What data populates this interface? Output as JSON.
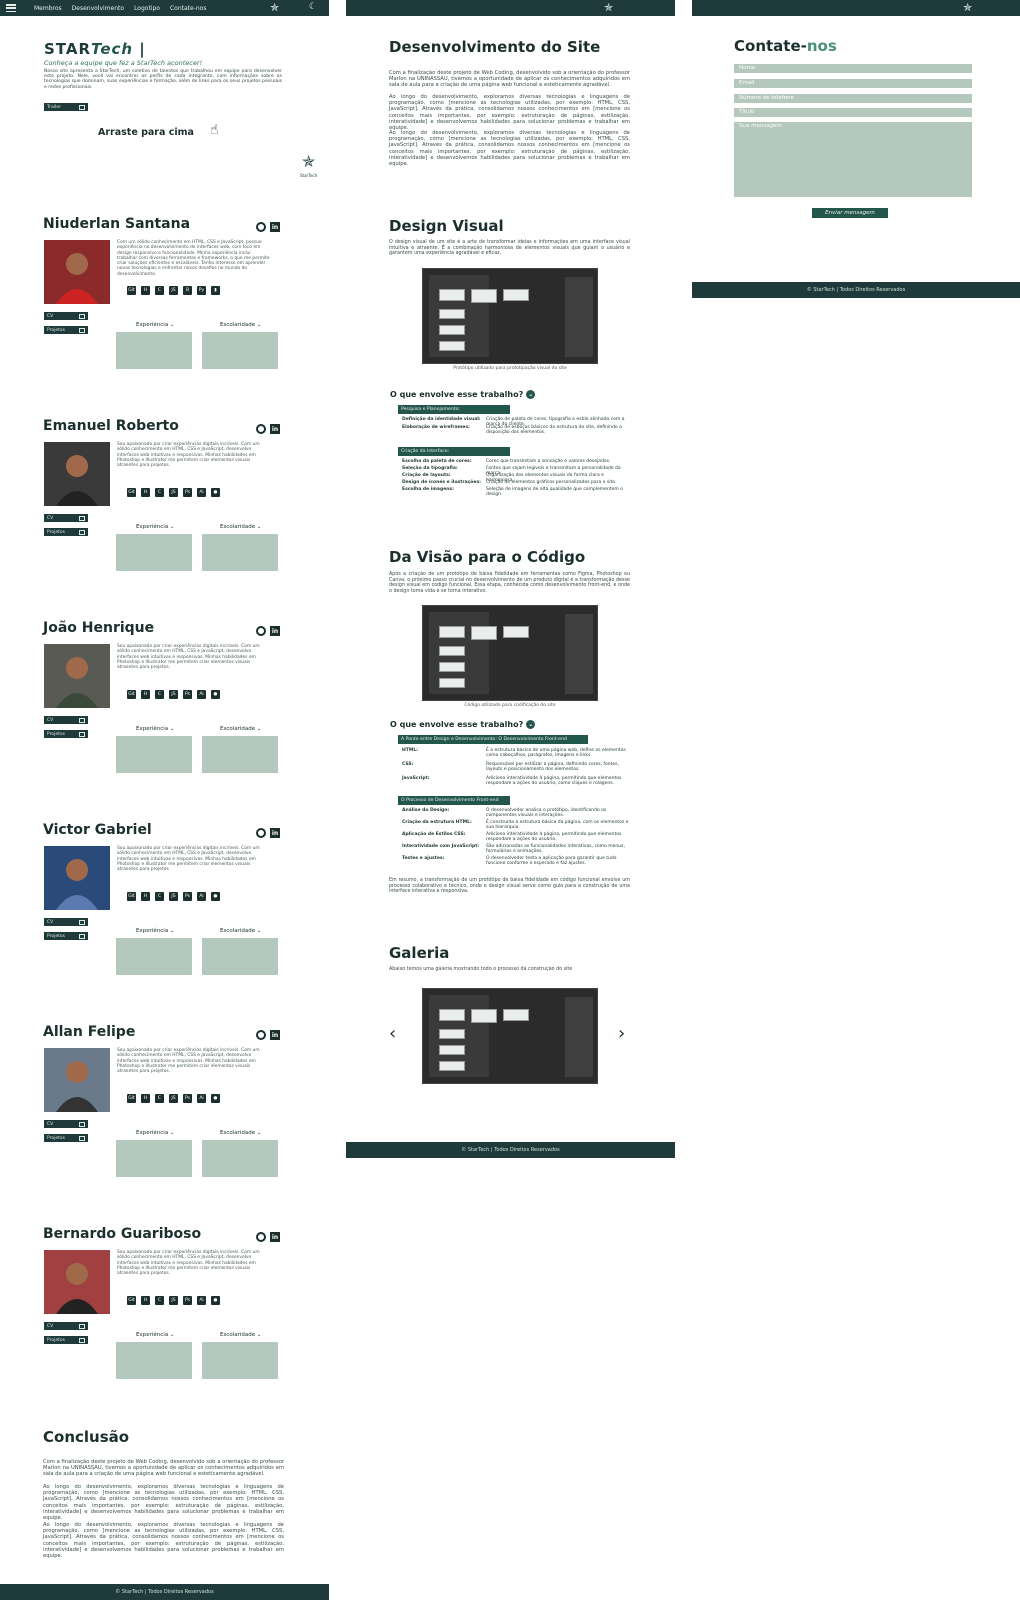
{
  "nav": {
    "links": [
      "Membros",
      "Desenvolvimento",
      "Logotipo",
      "Contate-nos"
    ]
  },
  "hero": {
    "brand_a": "STAR",
    "brand_b": "Tech",
    "tagline": "Conheça a equipe que fez a StarTech acontecer!",
    "text": "Nosso site apresenta a StarTech, um coletivo de talentos que trabalhou em equipe para desenvolver este projeto. Nele, você vai encontrar os perfis de cada integrante, com informações sobre as tecnologias que dominam, suas experiências e formação, além de links para os seus projetos pessoais e redes profissionais.",
    "button": "Trailer",
    "drag_hint": "Arraste para cima",
    "logo_caption": "StarTech"
  },
  "labels": {
    "cv": "CV",
    "projects": "Projetos",
    "experience": "Experiência",
    "education": "Escolaridade"
  },
  "members": [
    {
      "name": "Niuderlan Santana",
      "bio": "Com um sólido conhecimento em HTML, CSS e JavaScript, possuo experiência no desenvolvimento de interfaces web, com foco em design responsivo e funcionalidade. Minha experiência inclui trabalhar com diversas ferramentas e frameworks, o que me permite criar soluções eficientes e escaláveis. Tenho interesse em aprender novas tecnologias e enfrentar novos desafios no mundo do desenvolvimento.",
      "techs": [
        "Git",
        "H",
        "C",
        "JS",
        "B",
        "Py",
        "▮"
      ],
      "photo_bg": "#8a2a2a",
      "photo_fg": "#c22"
    },
    {
      "name": "Emanuel Roberto",
      "bio": "Sou apaixonado por criar experiências digitais incríveis. Com um sólido conhecimento em HTML, CSS e JavaScript, desenvolvo interfaces web intuitivas e responsivas. Minhas habilidades em Photoshop e Illustrator me permitem criar elementos visuais atraentes para projetos.",
      "techs": [
        "Git",
        "H",
        "C",
        "JS",
        "Ps",
        "Ai",
        "●"
      ],
      "photo_bg": "#3a3a3a",
      "photo_fg": "#222"
    },
    {
      "name": "João Henrique",
      "bio": "Sou apaixonado por criar experiências digitais incríveis. Com um sólido conhecimento em HTML, CSS e JavaScript, desenvolvo interfaces web intuitivas e responsivas. Minhas habilidades em Photoshop e Illustrator me permitem criar elementos visuais atraentes para projetos.",
      "techs": [
        "Git",
        "H",
        "C",
        "JS",
        "Ps",
        "Ai",
        "●"
      ],
      "photo_bg": "#5a5a55",
      "photo_fg": "#3a4a3a"
    },
    {
      "name": "Victor Gabriel",
      "bio": "Sou apaixonado por criar experiências digitais incríveis. Com um sólido conhecimento em HTML, CSS e JavaScript, desenvolvo interfaces web intuitivas e responsivas. Minhas habilidades em Photoshop e Illustrator me permitem criar elementos visuais atraentes para projetos.",
      "techs": [
        "Git",
        "H",
        "C",
        "JS",
        "Ps",
        "Ai",
        "●"
      ],
      "photo_bg": "#2a4a7a",
      "photo_fg": "#5a7ab0"
    },
    {
      "name": "Allan Felipe",
      "bio": "Sou apaixonado por criar experiências digitais incríveis. Com um sólido conhecimento em HTML, CSS e JavaScript, desenvolvo interfaces web intuitivas e responsivas. Minhas habilidades em Photoshop e Illustrator me permitem criar elementos visuais atraentes para projetos.",
      "techs": [
        "Git",
        "H",
        "C",
        "JS",
        "Ps",
        "Ai",
        "●"
      ],
      "photo_bg": "#6a7a8a",
      "photo_fg": "#333"
    },
    {
      "name": "Bernardo Guariboso",
      "bio": "Sou apaixonado por criar experiências digitais incríveis. Com um sólido conhecimento em HTML, CSS e JavaScript, desenvolvo interfaces web intuitivas e responsivas. Minhas habilidades em Photoshop e Illustrator me permitem criar elementos visuais atraentes para projetos.",
      "techs": [
        "Git",
        "H",
        "C",
        "JS",
        "Ps",
        "Ai",
        "●"
      ],
      "photo_bg": "#a04040",
      "photo_fg": "#222"
    }
  ],
  "conclusion": {
    "title": "Conclusão",
    "p1": "Com a finalização deste projeto de Web Coding, desenvolvido sob a orientação do professor Marlon na UNINASSAU, tivemos a oportunidade de aplicar os conhecimentos adquiridos em sala de aula para a criação de uma página web funcional e esteticamente agradável.",
    "p2": "Ao longo do desenvolvimento, exploramos diversas tecnologias e linguagens de programação, como [mencione as tecnologias utilizadas, por exemplo: HTML, CSS, JavaScript]. Através da prática, consolidamos nossos conhecimentos em [mencione os conceitos mais importantes, por exemplo: estruturação de páginas, estilização, interatividade] e desenvolvemos habilidades para solucionar problemas e trabalhar em equipe.",
    "p3": "Ao longo do desenvolvimento, exploramos diversas tecnologias e linguagens de programação, como [mencione as tecnologias utilizadas, por exemplo: HTML, CSS, JavaScript]. Através da prática, consolidamos nossos conhecimentos em [mencione os conceitos mais importantes, por exemplo: estruturação de páginas, estilização, interatividade] e desenvolvemos habilidades para solucionar problemas e trabalhar em equipe."
  },
  "footer": "© StarTech | Todos Direitos Reservados",
  "dev": {
    "title": "Desenvolvimento do Site",
    "p1": "Com a finalização deste projeto de Web Coding, desenvolvido sob a orientação do professor Marlon na UNINASSAU, tivemos a oportunidade de aplicar os conhecimentos adquiridos em sala de aula para a criação de uma página web funcional e esteticamente agradável.",
    "p2": "Ao longo do desenvolvimento, exploramos diversas tecnologias e linguagens de programação, como [mencione as tecnologias utilizadas, por exemplo: HTML, CSS, JavaScript]. Através da prática, consolidamos nossos conhecimentos em [mencione os conceitos mais importantes, por exemplo: estruturação de páginas, estilização, interatividade] e desenvolvemos habilidades para solucionar problemas e trabalhar em equipe.",
    "p3": "Ao longo do desenvolvimento, exploramos diversas tecnologias e linguagens de programação, como [mencione as tecnologias utilizadas, por exemplo: HTML, CSS, JavaScript]. Através da prática, consolidamos nossos conhecimentos em [mencione os conceitos mais importantes, por exemplo: estruturação de páginas, estilização, interatividade] e desenvolvemos habilidades para solucionar problemas e trabalhar em equipe."
  },
  "design": {
    "title": "Design Visual",
    "text": "O design visual de um site é a arte de transformar ideias e informações em uma interface visual intuitiva e atraente. É a combinação harmoniosa de elementos visuais que guiam o usuário e garantem uma experiência agradável e eficaz.",
    "caption": "Protótipo utilizado para prototipação visual do site",
    "question": "O que envolve esse trabalho?",
    "group1_head": "Pesquisa e Planejamento:",
    "group1": [
      {
        "k": "Definição da identidade visual:",
        "v": "Criação de paleta de cores, tipografia e estilo alinhado com a marca do cliente."
      },
      {
        "k": "Elaboração de wireframes:",
        "v": "Criação de esboços básicos da estrutura do site, definindo a disposição dos elementos."
      }
    ],
    "group2_head": "Criação da Interface:",
    "group2": [
      {
        "k": "Escolha da paleta de cores:",
        "v": "Cores que transmitam a sensação e valores desejados."
      },
      {
        "k": "Seleção da tipografia:",
        "v": "Fontes que sejam legíveis e transmitam a personalidade da marca."
      },
      {
        "k": "Criação de layouts:",
        "v": "Organização dos elementos visuais de forma clara e harmoniosa."
      },
      {
        "k": "Design de ícones e ilustrações:",
        "v": "Criação de elementos gráficos personalizados para o site."
      },
      {
        "k": "Escolha de imagens:",
        "v": "Seleção de imagens de alta qualidade que complementem o design."
      }
    ]
  },
  "vision": {
    "title": "Da Visão para o Código",
    "text": "Após a criação de um protótipo de baixa fidelidade em ferramentas como Figma, Photoshop ou Canva, o próximo passo crucial no desenvolvimento de um produto digital é a transformação desse design visual em código funcional. Essa etapa, conhecida como desenvolvimento front-end, é onde o design toma vida e se torna interativo.",
    "caption": "Código utilizado para codificação do site",
    "question": "O que envolve esse trabalho?",
    "group1_head": "A Ponte entre Design e Desenvolvimento: O Desenvolvimento Front-end",
    "group1": [
      {
        "k": "HTML:",
        "v": "É a estrutura básica de uma página web, define os elementos como cabeçalhos, parágrafos, imagens e links."
      },
      {
        "k": "CSS:",
        "v": "Responsável por estilizar a página, definindo cores, fontes, layouts e posicionamento dos elementos."
      },
      {
        "k": "JavaScript:",
        "v": "Adiciona interatividade à página, permitindo que elementos respondam a ações do usuário, como cliques e rolagens."
      }
    ],
    "group2_head": "O Processo de Desenvolvimento Front-end",
    "group2": [
      {
        "k": "Análise do Design:",
        "v": "O desenvolvedor analisa o protótipo, identificando os componentes visuais e interações."
      },
      {
        "k": "Criação da estrutura HTML:",
        "v": "É construída a estrutura básica da página, com os elementos e sua hierarquia."
      },
      {
        "k": "Aplicação de Estilos CSS:",
        "v": "Adiciona interatividade à página, permitindo que elementos respondam a ações do usuário."
      },
      {
        "k": "Interatividade com JavaScript:",
        "v": "São adicionadas as funcionalidades interativas, como menus, formulários e animações."
      },
      {
        "k": "Testes e ajustes:",
        "v": "O desenvolvedor testa a aplicação para garantir que tudo funcione conforme o esperado e faz ajustes."
      }
    ],
    "summary": "Em resumo, a transformação de um protótipo de baixa fidelidade em código funcional envolve um processo colaborativo e técnico, onde o design visual serve como guia para a construção de uma interface interativa e responsiva."
  },
  "gallery": {
    "title": "Galeria",
    "text": "Abaixo temos uma galeria mostrando todo o processo da construção do site"
  },
  "contact": {
    "title_a": "Contate-",
    "title_b": "nos",
    "name": "Nome",
    "email": "Email",
    "phone": "Número de telefone",
    "subject": "Título",
    "message": "Sua mensagem",
    "send": "Enviar mensagem"
  }
}
